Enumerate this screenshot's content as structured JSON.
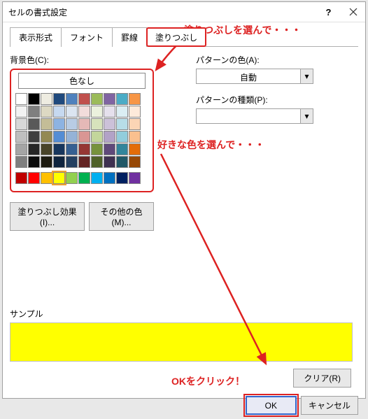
{
  "dialog": {
    "title": "セルの書式設定"
  },
  "tabs": {
    "display_format": "表示形式",
    "font": "フォント",
    "border": "罫線",
    "fill": "塗りつぶし"
  },
  "fill": {
    "bg_color_label": "背景色(C):",
    "no_color": "色なし",
    "effects_btn": "塗りつぶし効果(I)...",
    "more_colors_btn": "その他の色(M)..."
  },
  "pattern": {
    "color_label": "パターンの色(A):",
    "color_value": "自動",
    "type_label": "パターンの種類(P):",
    "type_value": ""
  },
  "sample": {
    "label": "サンプル",
    "color": "#ffff00"
  },
  "buttons": {
    "clear": "クリア(R)",
    "ok": "OK",
    "cancel": "キャンセル"
  },
  "annotations": {
    "select_fill": "塗りつぶしを選んで・・・",
    "select_color": "好きな色を選んで・・・",
    "click_ok": "OKをクリック！"
  },
  "palette": {
    "row1": [
      "#ffffff",
      "",
      "",
      "",
      "",
      "",
      "",
      "",
      "",
      ""
    ],
    "theme1": [
      "#ffffff",
      "#000000",
      "#eeece1",
      "#1f497d",
      "#4f81bd",
      "#c0504d",
      "#9bbb59",
      "#8064a2",
      "#4bacc6",
      "#f79646"
    ],
    "theme2": [
      "#f2f2f2",
      "#7f7f7f",
      "#ddd9c3",
      "#c6d9f0",
      "#dbe5f1",
      "#f2dcdb",
      "#ebf1dd",
      "#e5e0ec",
      "#dbeef3",
      "#fdeada"
    ],
    "theme3": [
      "#d8d8d8",
      "#595959",
      "#c4bd97",
      "#8db3e2",
      "#b8cce4",
      "#e5b9b7",
      "#d7e3bc",
      "#ccc1d9",
      "#b7dde8",
      "#fbd5b5"
    ],
    "theme4": [
      "#bfbfbf",
      "#3f3f3f",
      "#938953",
      "#548dd4",
      "#95b3d7",
      "#d99694",
      "#c3d69b",
      "#b2a2c7",
      "#92cddc",
      "#fac08f"
    ],
    "theme5": [
      "#a5a5a5",
      "#262626",
      "#494429",
      "#17365d",
      "#366092",
      "#953734",
      "#76923c",
      "#5f497a",
      "#31859b",
      "#e36c09"
    ],
    "theme6": [
      "#7f7f7f",
      "#0c0c0c",
      "#1d1b10",
      "#0f243e",
      "#244061",
      "#632423",
      "#4f6128",
      "#3f3151",
      "#205867",
      "#974806"
    ],
    "standard": [
      "#c00000",
      "#ff0000",
      "#ffc000",
      "#ffff00",
      "#92d050",
      "#00b050",
      "#00b0f0",
      "#0070c0",
      "#002060",
      "#7030a0"
    ]
  }
}
